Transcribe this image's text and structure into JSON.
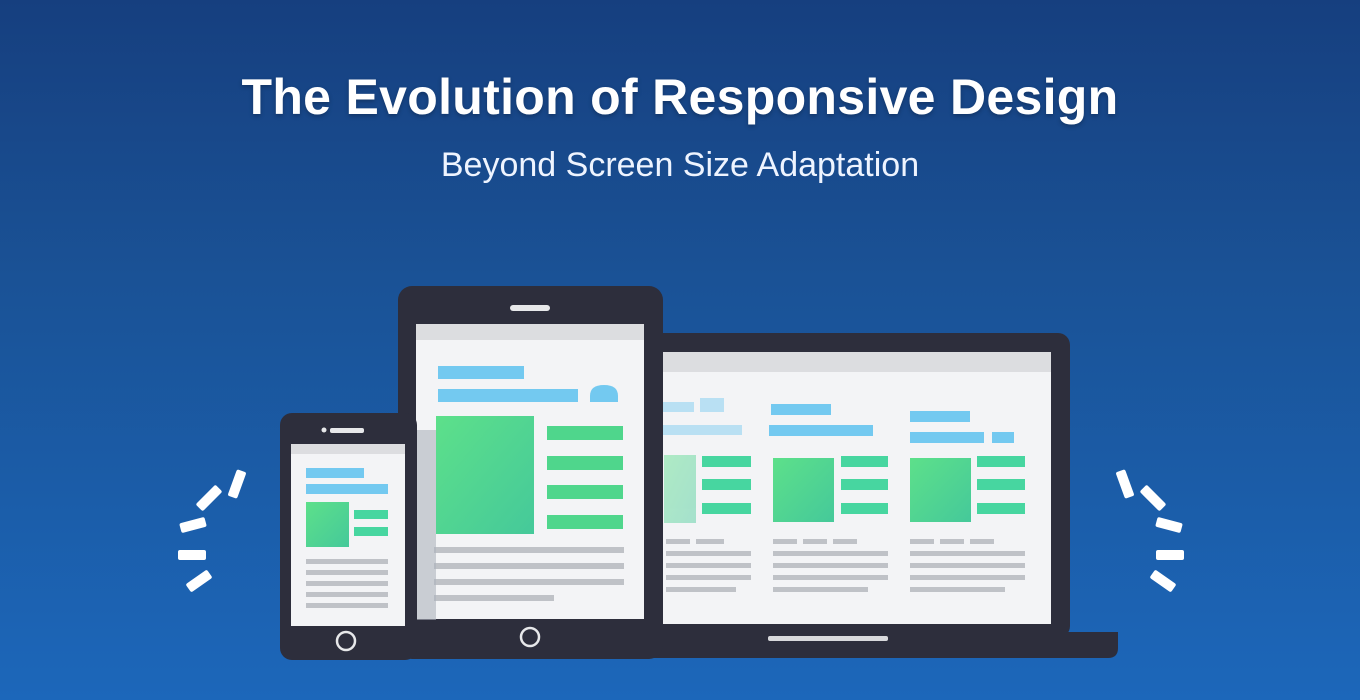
{
  "hero": {
    "title": "The Evolution of Responsive Design",
    "subtitle": "Beyond Screen Size Adaptation"
  },
  "devices": [
    "smartphone",
    "tablet",
    "laptop"
  ],
  "colors": {
    "background_top": "#163f7f",
    "background_bottom": "#1c67ba",
    "device_frame": "#2d2e3c",
    "screen": "#f3f4f6",
    "accent_blue": "#73c9f0",
    "accent_green": "#4fd68c",
    "accent_mint": "#47d6a0",
    "text_line_gray": "#bfc2c7"
  }
}
